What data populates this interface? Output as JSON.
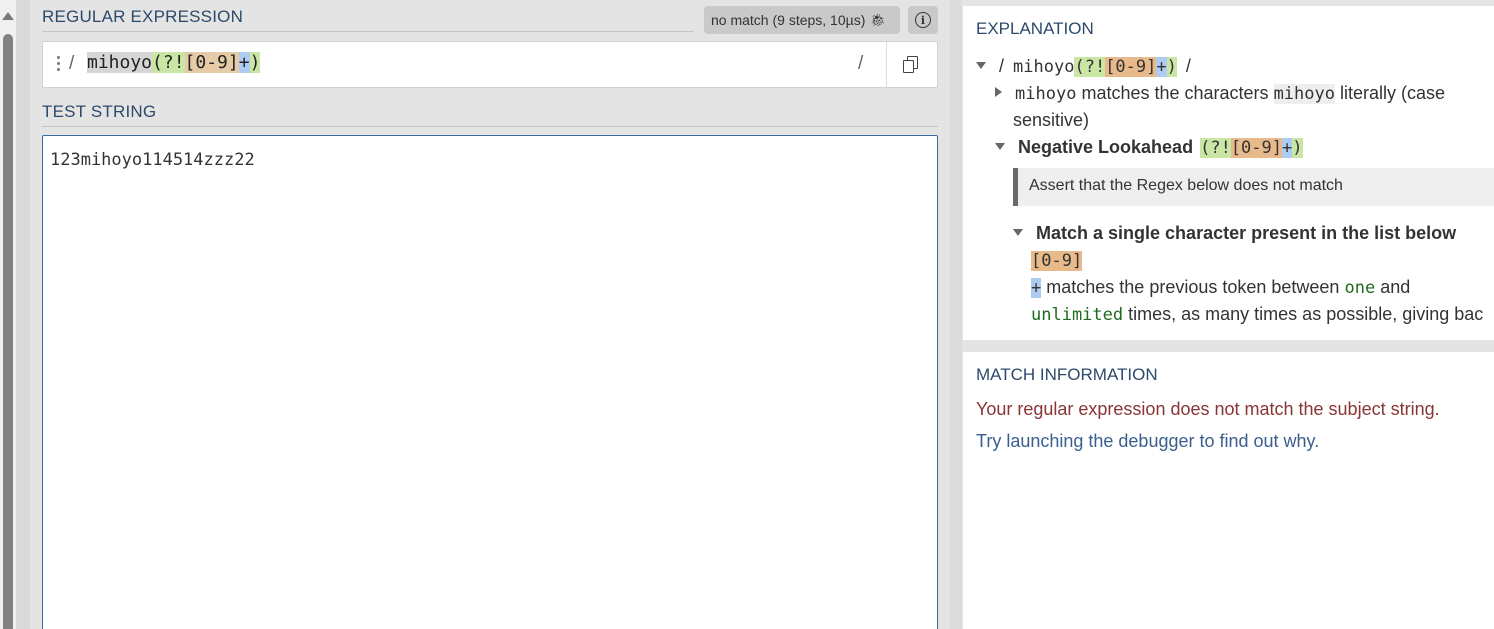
{
  "regex_section": {
    "title": "REGULAR EXPRESSION",
    "status_badge": "no match (9 steps, 10µs)",
    "debug_icon": "bug-icon",
    "info_icon": "info-icon",
    "open_delimiter": "/",
    "close_delimiter": "/",
    "pattern": {
      "literal": "mihoyo",
      "group_open": "(?!",
      "class": "[0-9]",
      "quantifier": "+",
      "group_close": ")"
    },
    "copy_icon": "copy-icon"
  },
  "test_section": {
    "title": "TEST STRING",
    "value": "123mihoyo114514zzz22"
  },
  "explanation": {
    "title": "EXPLANATION",
    "root": {
      "delim_open": "/",
      "literal": "mihoyo",
      "group_open": "(?!",
      "class": "[0-9]",
      "quantifier": "+",
      "group_close": ")",
      "delim_close": "/"
    },
    "literal_node": {
      "token": "mihoyo",
      "text_before": "matches the characters",
      "code": "mihoyo",
      "text_after": "literally (case",
      "text_line2": "sensitive)"
    },
    "lookahead_node": {
      "heading": "Negative Lookahead",
      "group_open": "(?!",
      "class": "[0-9]",
      "quantifier": "+",
      "group_close": ")"
    },
    "assert_text": "Assert that the Regex below does not match",
    "class_node": {
      "heading": "Match a single character present in the list below",
      "class": "[0-9]",
      "quantifier": "+",
      "text_1": "matches the previous token between",
      "word_one": "one",
      "text_and": "and",
      "word_unlimited": "unlimited",
      "text_2": "times, as many times as possible, giving bac"
    }
  },
  "match_info": {
    "title": "MATCH INFORMATION",
    "error": "Your regular expression does not match the subject string.",
    "tip": "Try launching the debugger to find out why."
  },
  "colors": {
    "section_title": "#2d4a6b",
    "error_text": "#8a3535",
    "link_text": "#3a5f8f",
    "group_highlight": "#c9e6a5",
    "class_highlight": "#e8b98a",
    "quantifier_highlight": "#aecbf2"
  }
}
